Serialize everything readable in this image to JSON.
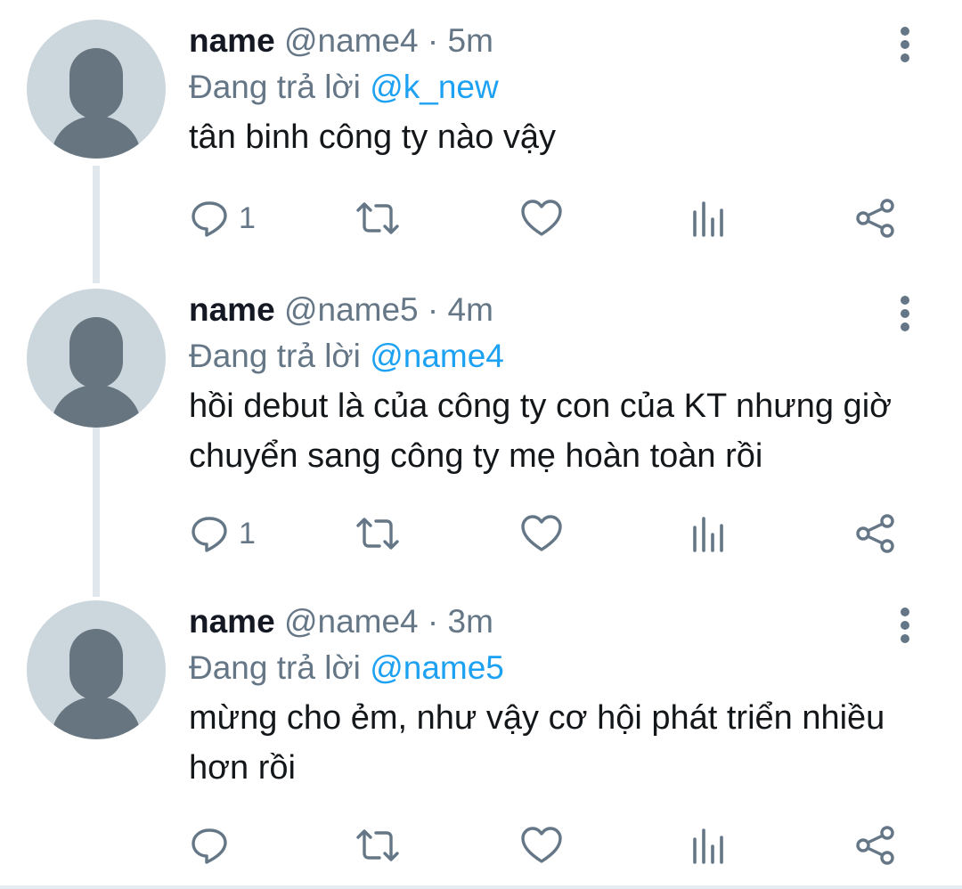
{
  "tweets": [
    {
      "name": "name",
      "handle": "@name4",
      "separator": "·",
      "time": "5m",
      "replying_prefix": "Đang trả lời",
      "replying_to": "@k_new",
      "text": "tân binh công ty nào vậy",
      "reply_count": "1"
    },
    {
      "name": "name",
      "handle": "@name5",
      "separator": "·",
      "time": "4m",
      "replying_prefix": "Đang trả lời",
      "replying_to": "@name4",
      "text": "hồi debut là của công ty con của KT nhưng giờ chuyển sang công ty mẹ hoàn toàn rồi",
      "reply_count": "1"
    },
    {
      "name": "name",
      "handle": "@name4",
      "separator": "·",
      "time": "3m",
      "replying_prefix": "Đang trả lời",
      "replying_to": "@name5",
      "text": "mừng cho ẻm, như vậy cơ hội phát triển nhiều hơn rồi",
      "reply_count": ""
    }
  ],
  "icons": {
    "reply": "reply-icon",
    "retweet": "retweet-icon",
    "like": "heart-icon",
    "analytics": "analytics-icon",
    "share": "share-icon",
    "more": "more-vertical-icon"
  },
  "colors": {
    "link": "#1da1f2",
    "secondary": "#657786",
    "avatar_bg": "#ccd6dd",
    "avatar_fg": "#66757f"
  }
}
